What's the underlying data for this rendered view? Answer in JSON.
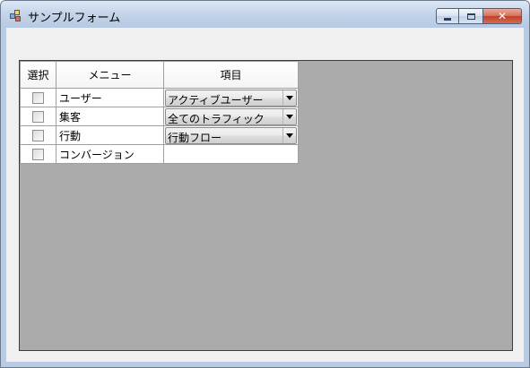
{
  "window": {
    "title": "サンプルフォーム"
  },
  "grid": {
    "headers": {
      "select": "選択",
      "menu": "メニュー",
      "item": "項目"
    },
    "rows": [
      {
        "checked": false,
        "menu": "ユーザー",
        "item": "アクティブユーザー",
        "has_combo": true
      },
      {
        "checked": false,
        "menu": "集客",
        "item": "全てのトラフィック",
        "has_combo": true
      },
      {
        "checked": false,
        "menu": "行動",
        "item": "行動フロー",
        "has_combo": true
      },
      {
        "checked": false,
        "menu": "コンバージョン",
        "item": "",
        "has_combo": false
      }
    ]
  }
}
